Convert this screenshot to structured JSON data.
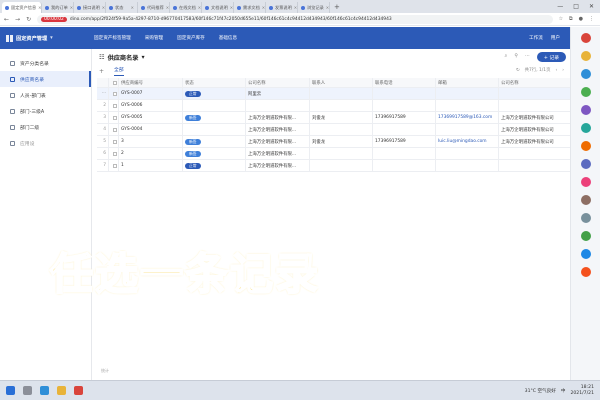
{
  "browser": {
    "tabs": [
      {
        "title": "固定资产信息",
        "active": true
      },
      {
        "title": "我的订单"
      },
      {
        "title": "接口说明"
      },
      {
        "title": "状态"
      },
      {
        "title": "代码推荐"
      },
      {
        "title": "在线文档"
      },
      {
        "title": "文档说明"
      },
      {
        "title": "需求文档"
      },
      {
        "title": "发票说明"
      },
      {
        "title": "浏览记录"
      }
    ],
    "recording_time": "00:00:02",
    "url": "dino.com/app/2f024f59-9a5a-4297-8710-d96770417583/60f146c71f47c2050d655e11/60f146c61c4c94412d434943/60f146c61c4c94412d434943",
    "window_controls": [
      "—",
      "□",
      "✕"
    ]
  },
  "app": {
    "name": "固定资产管理",
    "nav": [
      "固定资产标签管理",
      "采购管理",
      "固定资产库存",
      "基础信息"
    ],
    "header_right": [
      "工作流",
      "用户"
    ]
  },
  "sidebar": {
    "items": [
      {
        "label": "资产分类名录",
        "active": false
      },
      {
        "label": "供应商名录",
        "active": true
      },
      {
        "label": "人员-部门表",
        "active": false
      },
      {
        "label": "部门-三级A",
        "active": false
      },
      {
        "label": "部门二级",
        "active": false
      },
      {
        "label": "应用设",
        "active": false,
        "muted": true
      }
    ]
  },
  "main": {
    "title": "供应商名录",
    "add_button": "+ 记录",
    "view_tab": "全部",
    "pager": "共7行, 1/1页",
    "columns": [
      "",
      "",
      "供应商编号",
      "状态",
      "公司名称",
      "联系人",
      "联系电话",
      "邮箱",
      "公司名称"
    ],
    "rows": [
      {
        "idx": "···",
        "code": "GYS-0007",
        "status": "正常",
        "company": "阿里云",
        "contact": "",
        "phone": "",
        "email": "",
        "cname": "",
        "selected": true
      },
      {
        "idx": "2",
        "code": "GYS-0006",
        "status": "",
        "company": "",
        "contact": "",
        "phone": "",
        "email": "",
        "cname": ""
      },
      {
        "idx": "3",
        "code": "GYS-0005",
        "status": "新签",
        "company": "上海万企明道软件有限...",
        "contact": "刘俊龙",
        "phone": "17396917589",
        "email": "17369917589@163.com",
        "cname": "上海万企明道软件有限公司"
      },
      {
        "idx": "4",
        "code": "GYS-0004",
        "status": "",
        "company": "上海万企明道软件有限...",
        "contact": "",
        "phone": "",
        "email": "",
        "cname": "上海万企明道软件有限公司"
      },
      {
        "idx": "5",
        "code": "3",
        "status": "新签",
        "company": "上海万企明道软件有限...",
        "contact": "刘俊龙",
        "phone": "17396917589",
        "email": "luic.liu@mingdao.com",
        "cname": "上海万企明道软件有限公司"
      },
      {
        "idx": "6",
        "code": "2",
        "status": "新签",
        "company": "上海万企明道软件有限...",
        "contact": "",
        "phone": "",
        "email": "",
        "cname": ""
      },
      {
        "idx": "7",
        "code": "1",
        "status": "正常",
        "company": "上海万企明道软件有限...",
        "contact": "",
        "phone": "",
        "email": "",
        "cname": ""
      }
    ],
    "footer": "统计"
  },
  "caption": "任选一条记录",
  "taskbar": {
    "weather": "31°C 空气良好",
    "lang": "中",
    "time": "18:21",
    "date": "2021/7/21"
  },
  "colors": {
    "brand": "#2c5ab7",
    "caption": "#f6c51b"
  }
}
